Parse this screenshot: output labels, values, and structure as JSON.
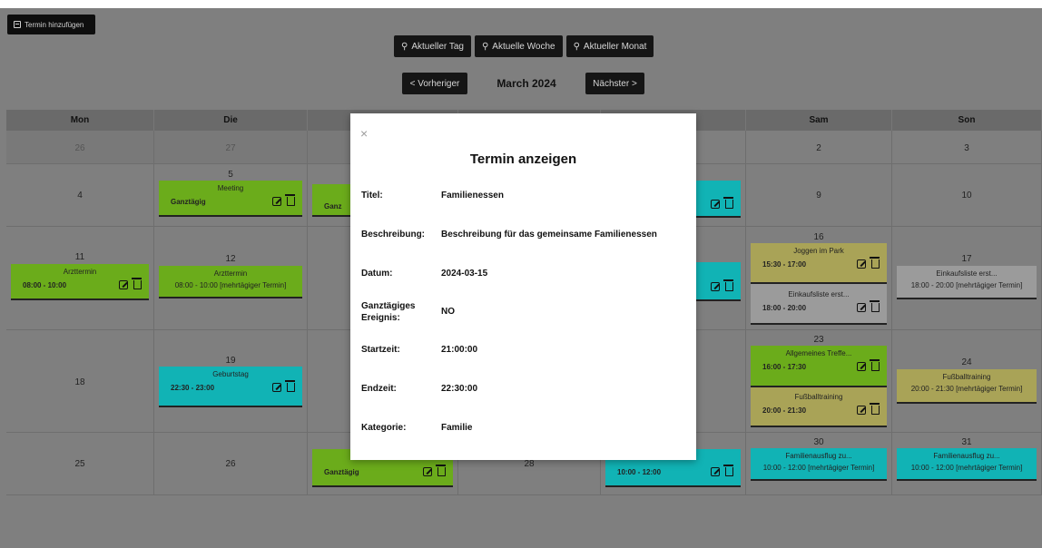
{
  "toolbar": {
    "add_label": "Termin hinzufügen"
  },
  "filters": [
    "Aktueller Tag",
    "Aktuelle Woche",
    "Aktueller Monat"
  ],
  "nav": {
    "prev": "< Vorheriger",
    "month": "March 2024",
    "next": "Nächster >"
  },
  "weekdays": [
    "Mon",
    "Die",
    "",
    "",
    "",
    "Sam",
    "Son"
  ],
  "dates": {
    "r1": [
      "26",
      "27",
      "2",
      "3"
    ],
    "r2": [
      "4",
      "5",
      "9",
      "10"
    ],
    "r3": [
      "11",
      "12",
      "16",
      "17"
    ],
    "r4": [
      "18",
      "19",
      "23",
      "24"
    ],
    "r5": [
      "25",
      "26",
      "28",
      "30",
      "31"
    ]
  },
  "events": {
    "meeting": {
      "title": "Meeting",
      "time": "Ganztägig"
    },
    "ganz_partial": "Ganz",
    "arzt1": {
      "title": "Arzttermin",
      "time": "08:00 - 10:00"
    },
    "arzt2": {
      "title": "Arzttermin",
      "sub": "08:00 - 10:00 [mehrtägiger Termin]"
    },
    "joggen": {
      "title": "Joggen im Park",
      "time": "15:30 - 17:00"
    },
    "einkauf1": {
      "title": "Einkaufsliste erst...",
      "time": "18:00 - 20:00"
    },
    "einkauf2": {
      "title": "Einkaufsliste erst...",
      "sub": "18:00 - 20:00 [mehrtägiger Termin]"
    },
    "geburtstag": {
      "title": "Geburtstag",
      "time": "22:30 - 23:00"
    },
    "allgemein": {
      "title": "Allgemeines Treffe...",
      "time": "16:00 - 17:30"
    },
    "fussball1": {
      "title": "Fußballtraining",
      "time": "20:00 - 21:30"
    },
    "fussball2": {
      "title": "Fußballtraining",
      "sub": "20:00 - 21:30 [mehrtägiger Termin]"
    },
    "wed27": {
      "time": "Ganztägig"
    },
    "fri29": {
      "time": "10:00 - 12:00"
    },
    "familie1": {
      "title": "Familienausflug zu...",
      "sub": "10:00 - 12:00 [mehrtägiger Termin]"
    },
    "familie2": {
      "title": "Familienausflug zu...",
      "sub": "10:00 - 12:00 [mehrtägiger Termin]"
    }
  },
  "modal": {
    "close": "×",
    "title": "Termin anzeigen",
    "fields": [
      {
        "k": "Titel:",
        "v": "Familienessen"
      },
      {
        "k": "Beschreibung:",
        "v": "Beschreibung für das gemeinsame Familienessen"
      },
      {
        "k": "Datum:",
        "v": "2024-03-15"
      },
      {
        "k": "Ganztägiges Ereignis:",
        "v": "NO"
      },
      {
        "k": "Startzeit:",
        "v": "21:00:00"
      },
      {
        "k": "Endzeit:",
        "v": "22:30:00"
      },
      {
        "k": "Kategorie:",
        "v": "Familie"
      }
    ]
  },
  "colors": {
    "green": "#6bac1b",
    "cyan": "#11b3b5",
    "olive": "#a9a357",
    "gray": "#9b9b9b",
    "overlay": "#7f7f7f"
  }
}
